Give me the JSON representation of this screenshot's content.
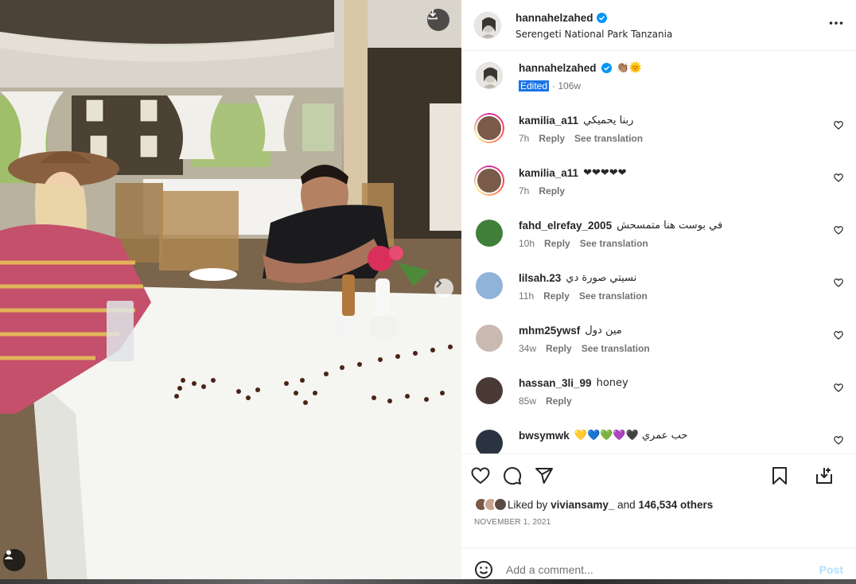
{
  "post": {
    "username": "hannahelzahed",
    "location": "Serengeti National Park Tanzania"
  },
  "caption": {
    "username": "hannahelzahed",
    "emojis": "👏🏽🌞",
    "edited_label": "Edited",
    "age": "· 106w"
  },
  "comments": [
    {
      "username": "kamilia_a11",
      "text": "ربنا يحميكي",
      "time": "7h",
      "reply": "Reply",
      "translate": "See translation",
      "avatar_color": "#7a5a48",
      "story_ring": true
    },
    {
      "username": "kamilia_a11",
      "text": "❤❤❤❤❤",
      "time": "7h",
      "reply": "Reply",
      "translate": "",
      "avatar_color": "#7a5a48",
      "story_ring": true
    },
    {
      "username": "fahd_elrefay_2005",
      "text": "في بوست هنا متمسحش",
      "time": "10h",
      "reply": "Reply",
      "translate": "See translation",
      "avatar_color": "#3f7f3a",
      "story_ring": false
    },
    {
      "username": "lilsah.23",
      "text": "نسيتي صورة دي",
      "time": "11h",
      "reply": "Reply",
      "translate": "See translation",
      "avatar_color": "#8fb3d9",
      "story_ring": false
    },
    {
      "username": "mhm25ywsf",
      "text": "مين دول",
      "time": "34w",
      "reply": "Reply",
      "translate": "See translation",
      "avatar_color": "#c9b9b0",
      "story_ring": false
    },
    {
      "username": "hassan_3li_99",
      "text": "honey",
      "time": "85w",
      "reply": "Reply",
      "translate": "",
      "avatar_color": "#4a3a35",
      "story_ring": false
    },
    {
      "username": "bwsymwk",
      "text": "💛💙💚💜🖤 حب عمري",
      "time": "",
      "reply": "",
      "translate": "",
      "avatar_color": "#2a3440",
      "story_ring": false
    }
  ],
  "likes": {
    "prefix": "Liked by",
    "by_user": "viviansamy_",
    "joiner": "and",
    "count": "146,534 others"
  },
  "date": "NOVEMBER 1, 2021",
  "add_comment": {
    "placeholder": "Add a comment...",
    "post_label": "Post"
  },
  "colors": {
    "verified": "#0095f6",
    "post_disabled": "#b2dffc",
    "meta_grey": "#737373"
  },
  "icons": [
    "download-icon",
    "tag-user-icon",
    "next-arrow-icon",
    "more-icon",
    "verified-icon",
    "heart-icon",
    "comment-icon",
    "share-icon",
    "bookmark-icon",
    "save-to-collection-icon",
    "emoji-icon"
  ]
}
